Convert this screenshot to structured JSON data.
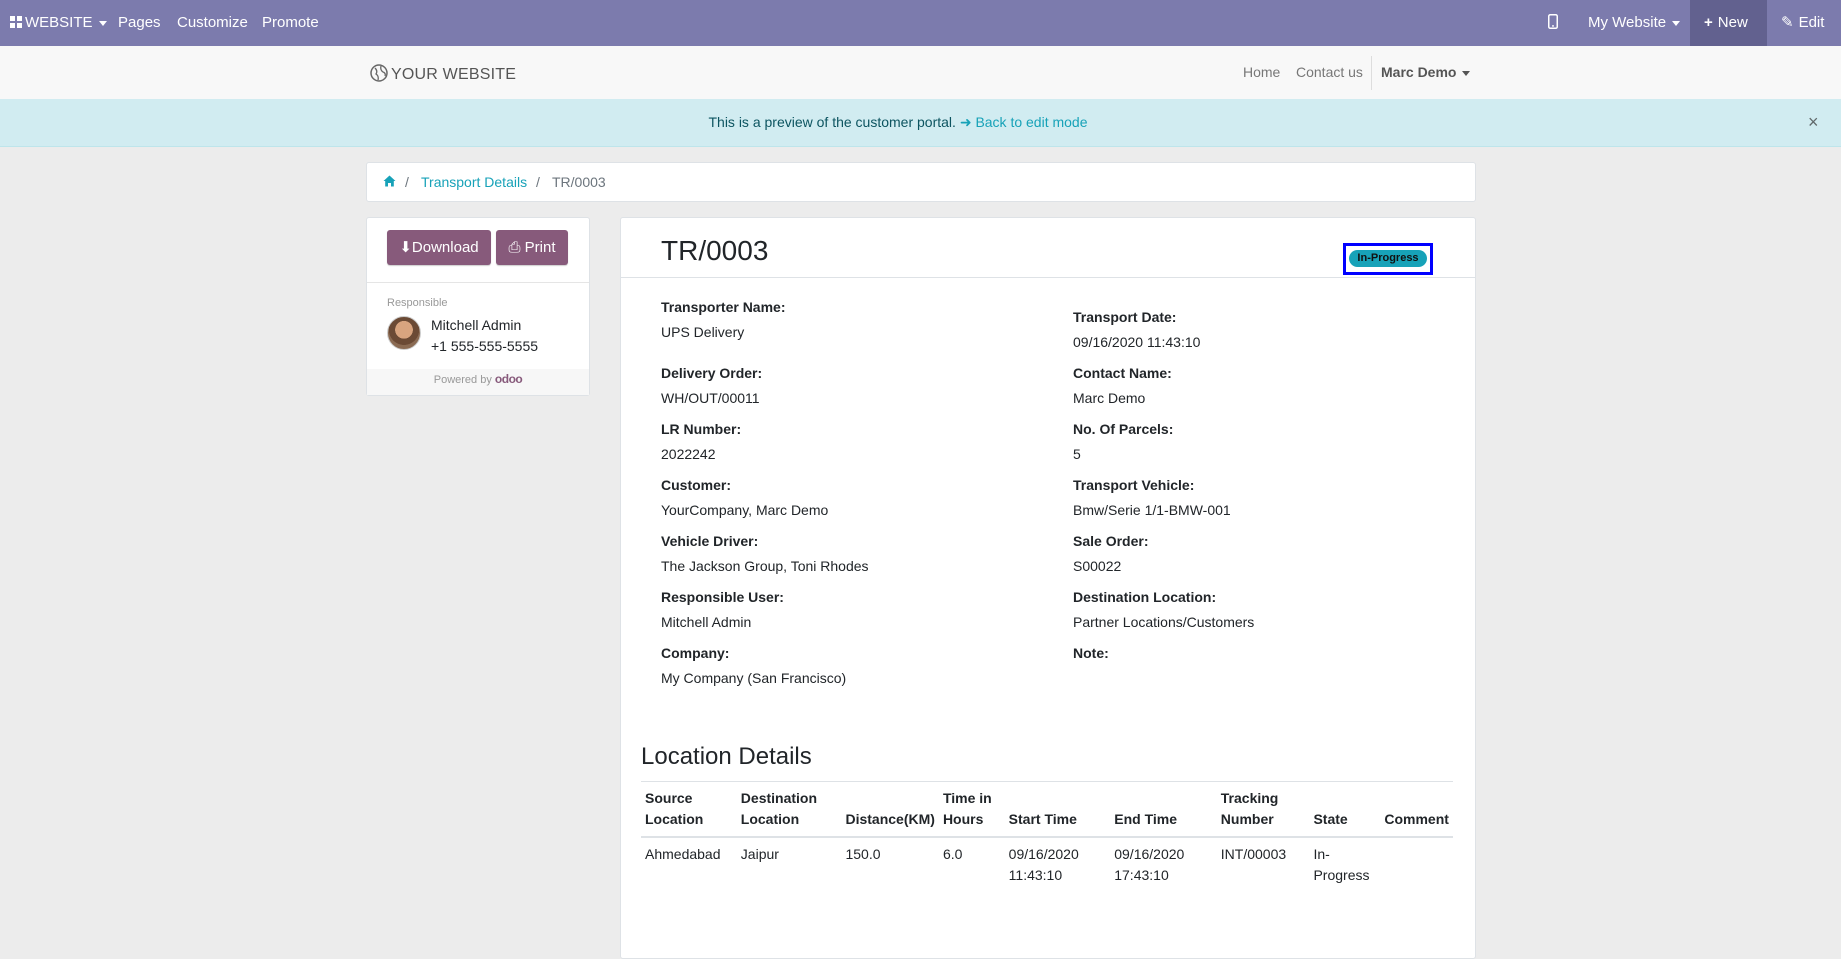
{
  "topbar": {
    "website_menu": "WEBSITE",
    "pages": "Pages",
    "customize": "Customize",
    "promote": "Promote",
    "my_website": "My Website",
    "new": "New",
    "edit": "Edit"
  },
  "header": {
    "logo": "YOUR WEBSITE",
    "nav": {
      "home": "Home",
      "contact": "Contact us",
      "user": "Marc Demo"
    }
  },
  "banner": {
    "message": "This is a preview of the customer portal.",
    "link": "Back to edit mode"
  },
  "breadcrumb": {
    "parent": "Transport Details",
    "current": "TR/0003"
  },
  "sidebar": {
    "download": "Download",
    "print": "Print",
    "responsible_label": "Responsible",
    "responsible_name": "Mitchell Admin",
    "responsible_phone": "+1 555-555-5555",
    "powered_by": "Powered by",
    "odoo": "odoo"
  },
  "record": {
    "title": "TR/0003",
    "status": "In-Progress",
    "status_color": "#17a2b8",
    "left_fields": [
      {
        "label": "Transporter Name:",
        "value": "UPS Delivery"
      },
      {
        "label": "Delivery Order:",
        "value": "WH/OUT/00011"
      },
      {
        "label": "LR Number:",
        "value": "2022242"
      },
      {
        "label": "Customer:",
        "value": "YourCompany, Marc Demo"
      },
      {
        "label": "Vehicle Driver:",
        "value": "The Jackson Group, Toni Rhodes"
      },
      {
        "label": "Responsible User:",
        "value": "Mitchell Admin"
      },
      {
        "label": "Company:",
        "value": "My Company (San Francisco)"
      }
    ],
    "right_fields": [
      {
        "label": "Transport Date:",
        "value": "09/16/2020 11:43:10"
      },
      {
        "label": "Contact Name:",
        "value": "Marc Demo"
      },
      {
        "label": "No. Of Parcels:",
        "value": "5"
      },
      {
        "label": "Transport Vehicle:",
        "value": "Bmw/Serie 1/1-BMW-001"
      },
      {
        "label": "Sale Order:",
        "value": "S00022"
      },
      {
        "label": "Destination Location:",
        "value": "Partner Locations/Customers"
      },
      {
        "label": "Note:",
        "value": ""
      }
    ]
  },
  "location_details": {
    "title": "Location Details",
    "columns": [
      [
        "Source",
        "Location"
      ],
      [
        "Destination",
        "Location"
      ],
      [
        "Distance(KM)"
      ],
      [
        "Time in",
        "Hours"
      ],
      [
        "Start Time"
      ],
      [
        "End Time"
      ],
      [
        "Tracking",
        "Number"
      ],
      [
        "State"
      ],
      [
        "Comment"
      ]
    ],
    "rows": [
      [
        [
          "Ahmedabad"
        ],
        [
          "Jaipur"
        ],
        [
          "150.0"
        ],
        [
          "6.0"
        ],
        [
          "09/16/2020",
          "11:43:10"
        ],
        [
          "09/16/2020",
          "17:43:10"
        ],
        [
          "INT/00003"
        ],
        [
          "In-",
          "Progress"
        ],
        [
          ""
        ]
      ]
    ]
  },
  "colors": {
    "topbar": "#7c7bad",
    "brand": "#875a7b",
    "link": "#17a2b8",
    "highlight": "#0000ff"
  }
}
